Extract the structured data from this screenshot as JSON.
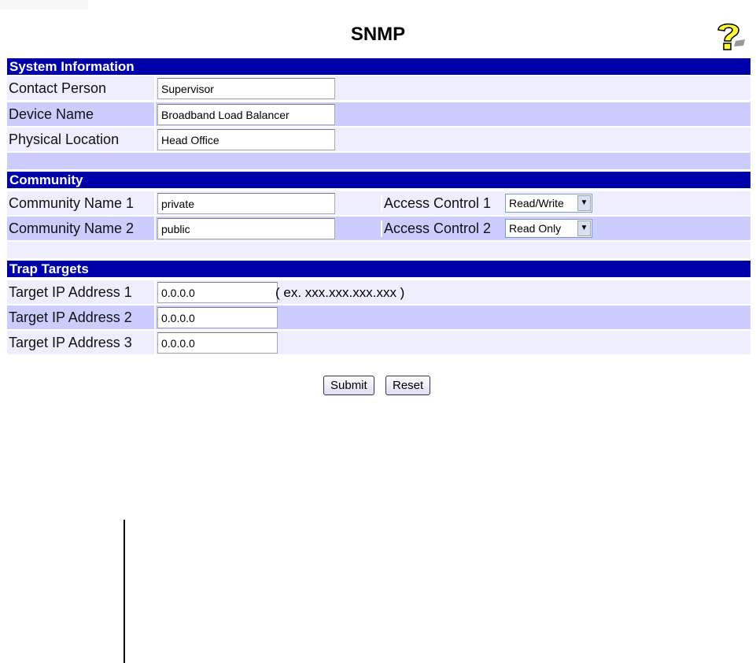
{
  "title": "SNMP",
  "sections": {
    "system": {
      "header": "System Information",
      "contact_label": "Contact Person",
      "contact_value": "Supervisor",
      "device_label": "Device Name",
      "device_value": "Broadband Load Balancer",
      "location_label": "Physical Location",
      "location_value": "Head Office"
    },
    "community": {
      "header": "Community",
      "rows": [
        {
          "name_label": "Community Name 1",
          "name_value": "private",
          "access_label": "Access Control 1",
          "access_value": "Read/Write"
        },
        {
          "name_label": "Community Name 2",
          "name_value": "public",
          "access_label": "Access Control 2",
          "access_value": "Read Only"
        }
      ]
    },
    "trap": {
      "header": "Trap Targets",
      "hint": "( ex. xxx.xxx.xxx.xxx )",
      "rows": [
        {
          "label": "Target IP Address 1",
          "value": "0.0.0.0"
        },
        {
          "label": "Target IP Address 2",
          "value": "0.0.0.0"
        },
        {
          "label": "Target IP Address 3",
          "value": "0.0.0.0"
        }
      ]
    }
  },
  "buttons": {
    "submit": "Submit",
    "reset": "Reset"
  }
}
